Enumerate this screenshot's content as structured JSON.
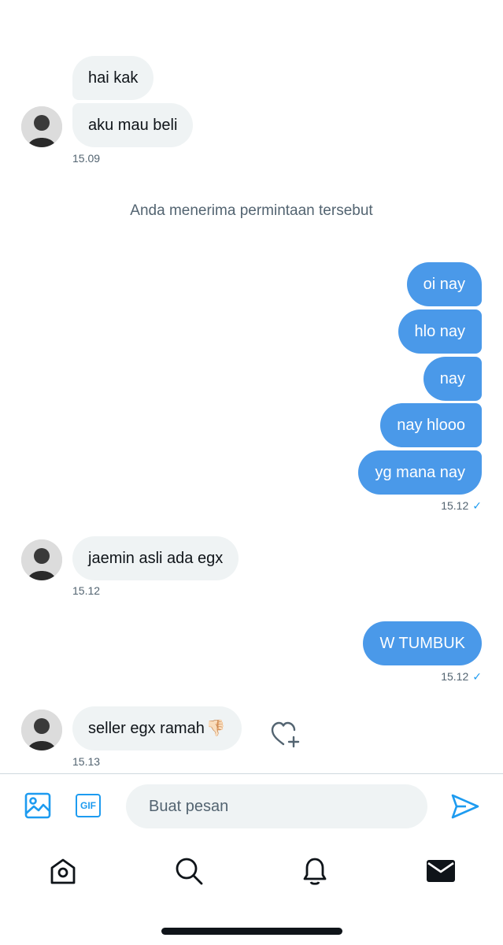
{
  "messages": [
    {
      "side": "in",
      "text": "hai kak"
    },
    {
      "side": "in",
      "text": "aku mau beli"
    },
    {
      "side": "in",
      "time": "15.09"
    },
    {
      "side": "system",
      "text": "Anda menerima permintaan tersebut"
    },
    {
      "side": "out",
      "text": "oi nay"
    },
    {
      "side": "out",
      "text": "hlo nay"
    },
    {
      "side": "out",
      "text": "nay"
    },
    {
      "side": "out",
      "text": "nay hlooo"
    },
    {
      "side": "out",
      "text": "yg mana nay"
    },
    {
      "side": "out",
      "time": "15.12"
    },
    {
      "side": "in",
      "text": "jaemin asli ada egx",
      "time": "15.12"
    },
    {
      "side": "out",
      "text": "W TUMBUK",
      "time": "15.12"
    },
    {
      "side": "in",
      "text": "seller egx ramah",
      "emoji": "👎🏻",
      "time": "15.13"
    }
  ],
  "read_receipt_symbol": "✓",
  "composer": {
    "placeholder": "Buat pesan"
  },
  "icons": {
    "media": "image-icon",
    "gif": "gif-icon",
    "gif_label": "GIF",
    "send": "send-icon",
    "react": "heart-plus-icon"
  },
  "bottom_nav": [
    {
      "name": "home-icon"
    },
    {
      "name": "search-icon"
    },
    {
      "name": "notifications-icon"
    },
    {
      "name": "messages-icon"
    }
  ],
  "colors": {
    "incoming_bubble": "#eff3f4",
    "outgoing_bubble": "#4a99e9",
    "accent": "#1d9bf0",
    "muted_text": "#536471"
  }
}
